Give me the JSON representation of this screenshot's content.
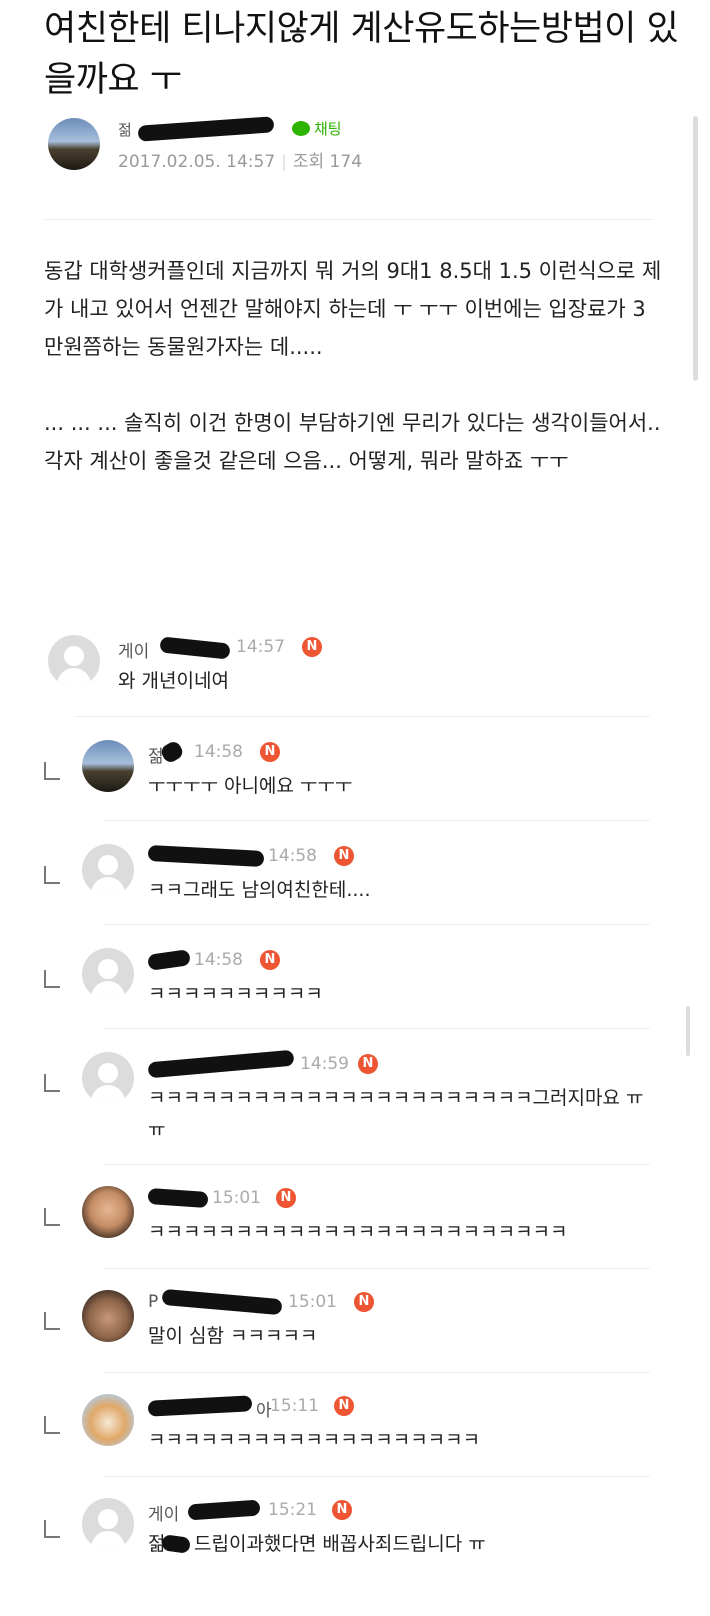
{
  "post": {
    "title": "여친한테 티나지않게 계산유도하는방법이 있을까요 ㅜ",
    "author": {
      "name_prefix": "젊",
      "chat_label": "채팅",
      "date": "2017.02.05. 14:57",
      "views": "조회 174"
    },
    "body": "동갑 대학생커플인데 지금까지 뭐 거의 9대1 8.5대 1.5 이런식으로 제가 내고 있어서 언젠간 말해야지 하는데 ㅜ ㅜㅜ 이번에는 입장료가 3만원쯤하는 동물원가자는 데.....\n\n... ... ... 솔직히 이건 한명이 부담하기엔 무리가 있다는 생각이들어서.. 각자 계산이 좋을것 같은데 으음... 어떻게, 뭐라 말하죠 ㅜㅜ"
  },
  "comments": [
    {
      "name": "게이",
      "time": "14:57",
      "badge": "N",
      "text": "와 개년이네여",
      "reply": false
    },
    {
      "name": "젊",
      "time": "14:58",
      "badge": "N",
      "text": "ㅜㅜㅜㅜ 아니에요 ㅜㅜㅜ",
      "reply": true
    },
    {
      "name": "",
      "time": "14:58",
      "badge": "N",
      "text": "ㅋㅋ그래도 남의여친한테....",
      "reply": true
    },
    {
      "name": "",
      "time": "14:58",
      "badge": "N",
      "text": "ㅋㅋㅋㅋㅋㅋㅋㅋㅋㅋ",
      "reply": true
    },
    {
      "name": "",
      "time": "14:59",
      "badge": "N",
      "text": "ㅋㅋㅋㅋㅋㅋㅋㅋㅋㅋㅋㅋㅋㅋㅋㅋㅋㅋㅋㅋㅋㅋ그러지마요 ㅠㅠ",
      "reply": true
    },
    {
      "name": "",
      "time": "15:01",
      "badge": "N",
      "text": "ㅋㅋㅋㅋㅋㅋㅋㅋㅋㅋㅋㅋㅋㅋㅋㅋㅋㅋㅋㅋㅋㅋㅋㅋ",
      "reply": true
    },
    {
      "name": "P",
      "time": "15:01",
      "badge": "N",
      "text": "말이 심함 ㅋㅋㅋㅋㅋ",
      "reply": true
    },
    {
      "name": "아",
      "time": "15:11",
      "badge": "N",
      "text": "ㅋㅋㅋㅋㅋㅋㅋㅋㅋㅋㅋㅋㅋㅋㅋㅋㅋㅋㅋ",
      "reply": true
    },
    {
      "name": "게이",
      "time": "15:21",
      "badge": "N",
      "text": "드립이과했다면 배꼽사죄드립니다 ㅠ",
      "text_prefix": "젊",
      "reply": true
    }
  ]
}
